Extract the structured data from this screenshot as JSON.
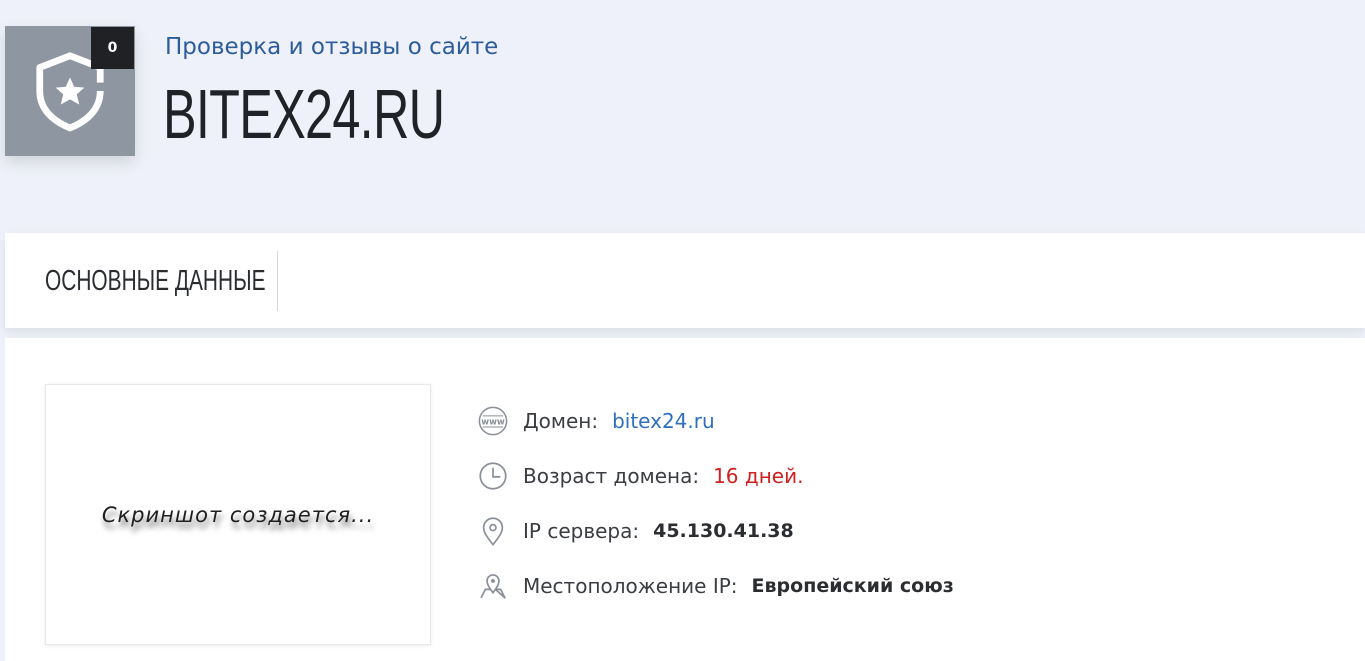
{
  "header": {
    "counter": "0",
    "subtitle": "Проверка и отзывы о сайте",
    "title": "BITEX24.RU"
  },
  "tabs": [
    {
      "label": "ОСНОВНЫЕ ДАННЫЕ"
    }
  ],
  "screenshot": {
    "placeholder_text": "Скриншот создается..."
  },
  "info": [
    {
      "icon": "www-icon",
      "label": "Домен:",
      "value": "bitex24.ru"
    },
    {
      "icon": "clock-icon",
      "label": "Возраст домена:",
      "value": "16 дней."
    },
    {
      "icon": "location-pin-icon",
      "label": "IP сервера:",
      "value": "45.130.41.38"
    },
    {
      "icon": "map-pin-icon",
      "label": "Местоположение IP:",
      "value": "Европейский союз"
    }
  ],
  "colors": {
    "link": "#2f6fbf",
    "warning": "#d0201f",
    "subtitle": "#2d5c9b",
    "badge_bg": "#8e97a1"
  }
}
